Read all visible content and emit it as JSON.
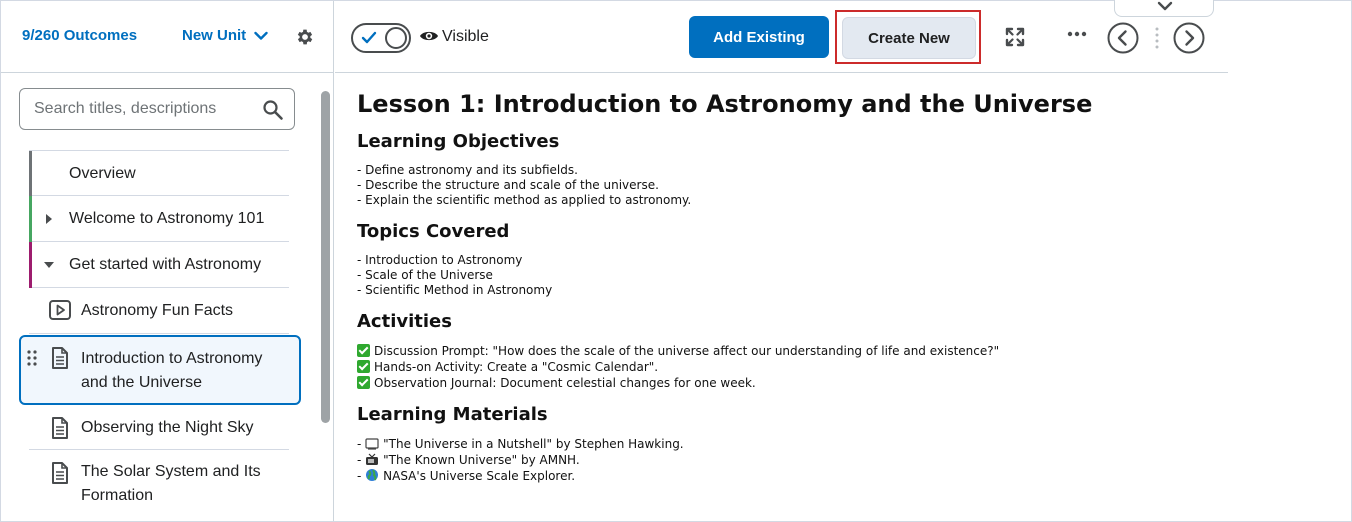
{
  "sidebar": {
    "outcomes": "9/260 Outcomes",
    "new_unit": "New Unit",
    "search_placeholder": "Search titles, descriptions",
    "nav": [
      {
        "label": "Overview",
        "color": "#6e7376"
      },
      {
        "label": "Welcome to Astronomy 101",
        "color": "#46a661"
      },
      {
        "label": "Get started with Astronomy",
        "color": "#9d1c6e"
      }
    ],
    "items": [
      {
        "label": "Astronomy Fun Facts",
        "icon": "video-icon"
      },
      {
        "label_line1": "Introduction to Astronomy",
        "label_line2": "and the Universe",
        "icon": "document-icon",
        "selected": true
      },
      {
        "label": "Observing the Night Sky",
        "icon": "document-icon"
      },
      {
        "label_line1": "The Solar System and Its",
        "label_line2": "Formation",
        "icon": "document-icon"
      }
    ]
  },
  "toolbar": {
    "visibility_label": "Visible",
    "add_existing": "Add Existing",
    "create_new": "Create New",
    "accent": "#006fbf",
    "highlight": "#cc2b2b"
  },
  "content": {
    "title": "Lesson 1: Introduction to Astronomy and the Universe",
    "sections": {
      "objectives": {
        "heading": "Learning Objectives",
        "items": [
          "- Define astronomy and its subfields.",
          "- Describe the structure and scale of the universe.",
          "- Explain the scientific method as applied to astronomy."
        ]
      },
      "topics": {
        "heading": "Topics Covered",
        "items": [
          "- Introduction to Astronomy",
          "- Scale of the Universe",
          "- Scientific Method in Astronomy"
        ]
      },
      "activities": {
        "heading": "Activities",
        "items": [
          "Discussion Prompt: \"How does the scale of the universe affect our understanding of life and existence?\"",
          "Hands-on Activity: Create a \"Cosmic Calendar\".",
          "Observation Journal: Document celestial changes for one week."
        ]
      },
      "materials": {
        "heading": "Learning Materials",
        "items": [
          {
            "prefix": "- ",
            "icon": "book-icon",
            "text": "\"The Universe in a Nutshell\" by Stephen Hawking."
          },
          {
            "prefix": "- ",
            "icon": "tv-icon",
            "text": "\"The Known Universe\" by AMNH."
          },
          {
            "prefix": "- ",
            "icon": "globe-icon",
            "text": "NASA's Universe Scale Explorer."
          }
        ]
      }
    }
  }
}
